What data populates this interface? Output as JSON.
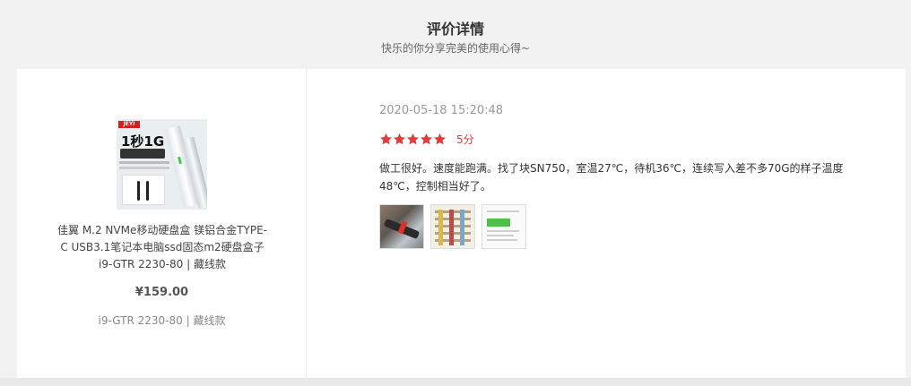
{
  "header": {
    "title": "评价详情",
    "subtitle": "快乐的你分享完美的使用心得~"
  },
  "product": {
    "image_name": "product-image",
    "image_brand": "JEYI",
    "image_headline": "1秒1G",
    "title": "佳翼 M.2 NVMe移动硬盘盒 镁铝合金TYPE-C USB3.1笔记本电脑ssd固态m2硬盘盒子 i9-GTR 2230-80 | 藏线款",
    "price": "¥159.00",
    "variant": "i9-GTR 2230-80 | 藏线款"
  },
  "review": {
    "time": "2020-05-18 15:20:48",
    "rating": 5,
    "score_label": "5分",
    "text": "做工很好。速度能跑满。找了块SN750，室温27℃，待机36℃，连续写入差不多70G的样子温度48℃，控制相当好了。",
    "images": [
      "review-photo-1",
      "review-photo-2",
      "review-photo-3"
    ],
    "star_color": "#e23b3b"
  }
}
